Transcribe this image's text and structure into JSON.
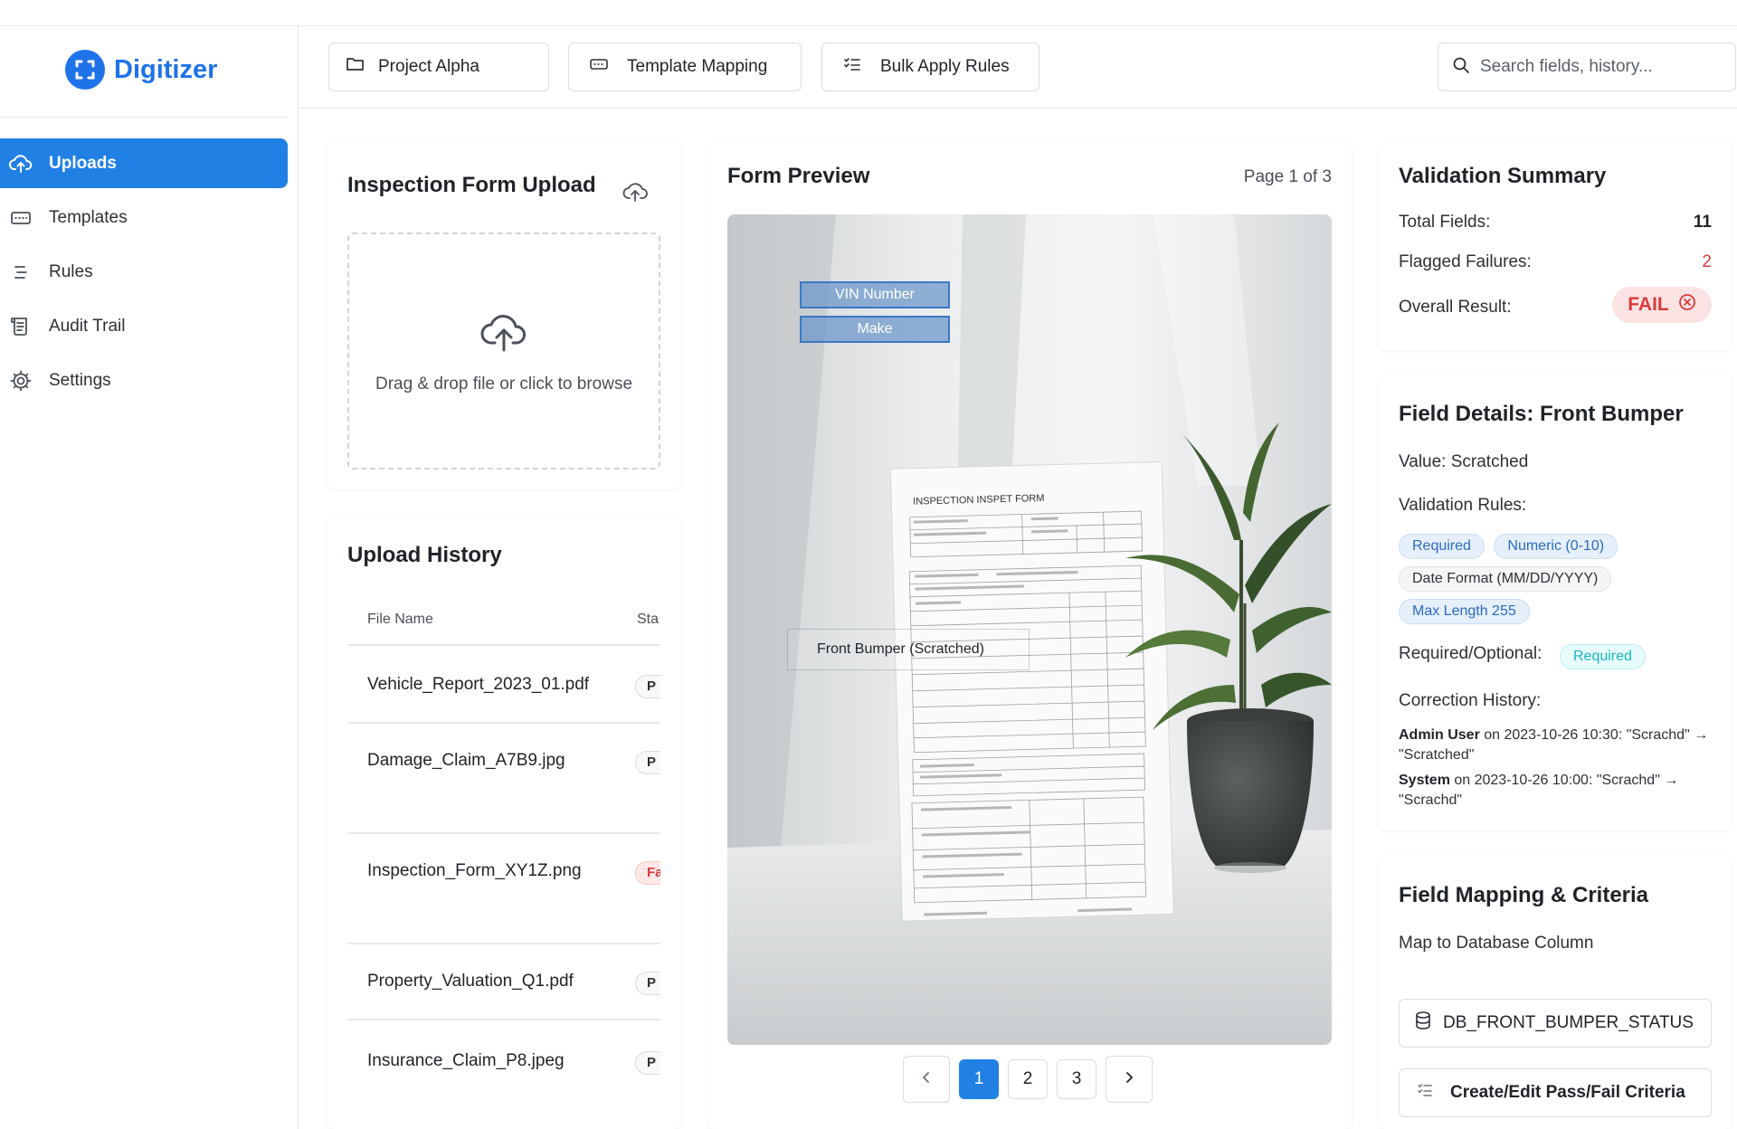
{
  "brand": {
    "name": "Digitizer"
  },
  "sidebar": {
    "items": [
      {
        "label": "Uploads",
        "icon": "cloud-upload-icon",
        "active": true
      },
      {
        "label": "Templates",
        "icon": "template-icon"
      },
      {
        "label": "Rules",
        "icon": "rules-icon"
      },
      {
        "label": "Audit Trail",
        "icon": "audit-trail-icon"
      },
      {
        "label": "Settings",
        "icon": "gear-icon"
      }
    ]
  },
  "toolbar": {
    "project_label": "Project Alpha",
    "template_mapping_label": "Template Mapping",
    "bulk_apply_label": "Bulk Apply Rules",
    "search_placeholder": "Search fields, history..."
  },
  "upload": {
    "title": "Inspection Form Upload",
    "dropzone_text": "Drag & drop file or click to browse"
  },
  "history": {
    "title": "Upload History",
    "columns": [
      "File Name",
      "Sta"
    ],
    "rows": [
      {
        "file": "Vehicle_Report_2023_01.pdf",
        "status": "P"
      },
      {
        "file": "Damage_Claim_A7B9.jpg",
        "status": "P"
      },
      {
        "file": "Inspection_Form_XY1Z.png",
        "status": "Fa"
      },
      {
        "file": "Property_Valuation_Q1.pdf",
        "status": "P"
      },
      {
        "file": "Insurance_Claim_P8.jpeg",
        "status": "P"
      }
    ]
  },
  "preview": {
    "title": "Form Preview",
    "page_indicator": "Page 1 of 3",
    "form_heading": "INSPECTION INSPET FORM",
    "overlays": {
      "vin": "VIN Number",
      "make": "Make",
      "bumper": "Front Bumper (Scratched)"
    },
    "pages": [
      "1",
      "2",
      "3"
    ],
    "current_page": "1"
  },
  "summary": {
    "title": "Validation Summary",
    "total_label": "Total Fields:",
    "total_value": "11",
    "flagged_label": "Flagged Failures:",
    "flagged_value": "2",
    "result_label": "Overall Result:",
    "result_value": "FAIL"
  },
  "field_details": {
    "title": "Field Details: Front Bumper",
    "value_line": "Value: Scratched",
    "rules_label": "Validation Rules:",
    "rules": [
      "Required",
      "Numeric (0-10)",
      "Date Format (MM/DD/YYYY)",
      "Max Length 255"
    ],
    "required_label": "Required/Optional:",
    "required_value": "Required",
    "correction_label": "Correction History:",
    "corrections": [
      {
        "user": "Admin User",
        "text": " on 2023-10-26 10:30: \"Scrachd\" → \"Scratched\""
      },
      {
        "user": "System",
        "text": " on 2023-10-26 10:00: \"Scrachd\" → \"Scrachd\""
      }
    ]
  },
  "mapping": {
    "title": "Field Mapping & Criteria",
    "column_label": "Map to Database Column",
    "column_value": "DB_FRONT_BUMPER_STATUS",
    "criteria_button": "Create/Edit Pass/Fail Criteria"
  },
  "colors": {
    "accent": "#2180e3",
    "brand": "#1f73e8",
    "fail": "#d93b3b",
    "required": "#18b7c5"
  }
}
